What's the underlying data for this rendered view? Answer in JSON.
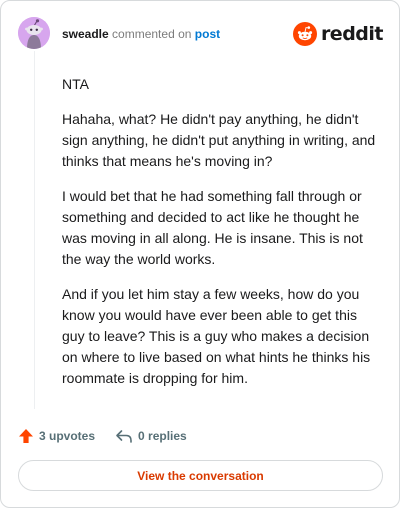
{
  "header": {
    "username": "sweadle",
    "action_text": "commented on",
    "post_link": "post",
    "brand": "reddit"
  },
  "comment": {
    "paragraphs": [
      "NTA",
      "Hahaha, what? He didn't pay anything, he didn't sign anything, he didn't put anything in writing, and thinks that means he's moving in?",
      "I would bet that he had something fall through or something and decided to act like he thought he was moving in all along. He is insane. This is not the way the world works.",
      "And if you let him stay a few weeks, how do you know you would have ever been able to get this guy to leave? This is a guy who makes a decision on where to live based on what hints he thinks his roommate is dropping for him."
    ]
  },
  "actions": {
    "upvotes": "3 upvotes",
    "replies": "0 replies",
    "upvote_icon": "upvote-arrow-icon",
    "reply_icon": "reply-arrow-icon"
  },
  "cta": {
    "label": "View the conversation"
  },
  "colors": {
    "accent": "#d93a00",
    "reddit_orange": "#ff4500",
    "link_blue": "#0079d3",
    "avatar_bg": "#d7a6ee"
  }
}
